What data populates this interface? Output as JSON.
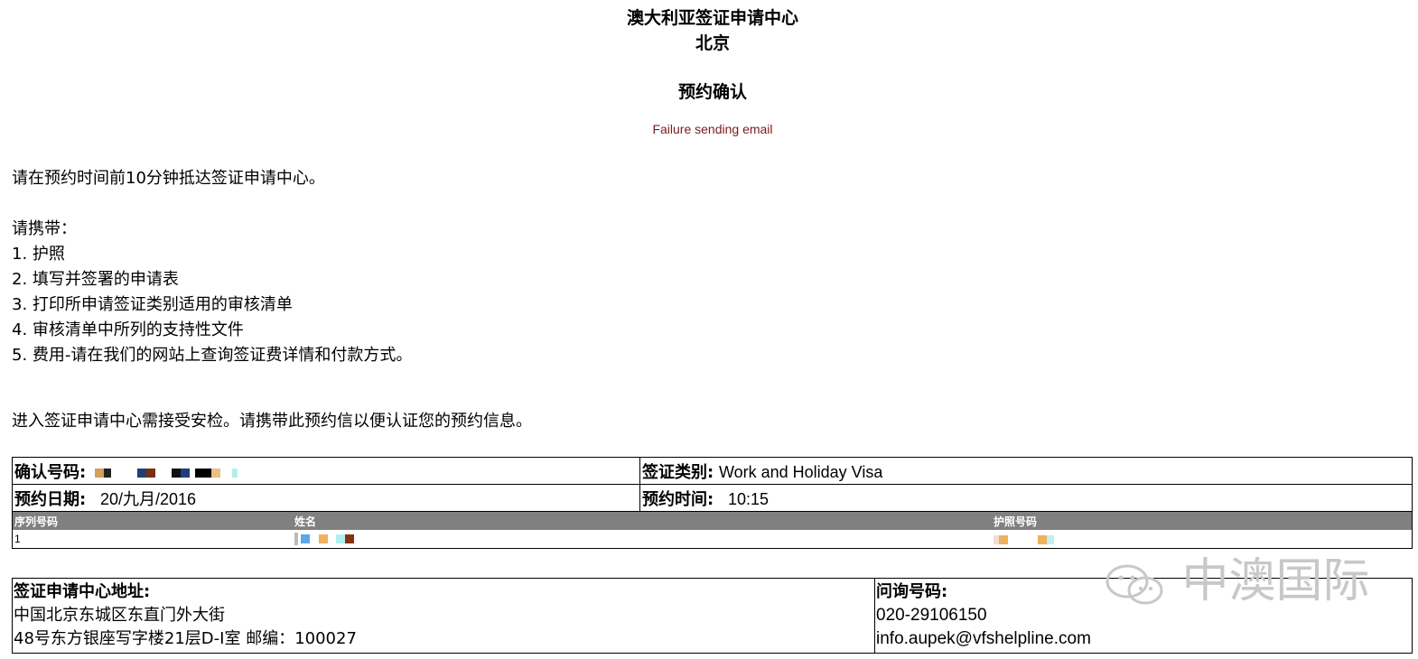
{
  "header": {
    "center_name": "澳大利亚签证申请中心",
    "city": "北京",
    "confirmation_title": "预约确认",
    "error_message": "Failure sending email"
  },
  "instructions": {
    "arrive_note": "请在预约时间前10分钟抵达签证申请中心。",
    "bring_label": "请携带：",
    "items": [
      "1. 护照",
      "2. 填写并签署的申请表",
      "3. 打印所申请签证类别适用的审核清单",
      "4. 审核清单中所列的支持性文件",
      "5. 费用-请在我们的网站上查询签证费详情和付款方式。"
    ],
    "security_note": "进入签证申请中心需接受安检。请携带此预约信以便认证您的预约信息。"
  },
  "appointment": {
    "confirmation_label": "确认号码",
    "visa_type_label": "签证类别:",
    "visa_type_value": "Work and Holiday Visa",
    "date_label": "预约日期:",
    "date_value": "20/九月/2016",
    "time_label": "预约时间:",
    "time_value": "10:15",
    "applicants_headers": [
      "序列号码",
      "姓名",
      "护照号码"
    ],
    "applicants": [
      {
        "seq": "1"
      }
    ]
  },
  "address": {
    "label": "签证申请中心地址:",
    "line1": "中国北京东城区东直门外大街",
    "line2": "48号东方银座写字楼21层D-I室 邮编：100027",
    "contact_label": "问询号码:",
    "phone": "020-29106150",
    "email": "info.aupek@vfshelpline.com"
  },
  "watermark": {
    "text": "中澳国际"
  },
  "colors": {
    "error": "#7a1a1a",
    "table_header_bg": "#808080",
    "watermark": "#c8c8c8"
  }
}
